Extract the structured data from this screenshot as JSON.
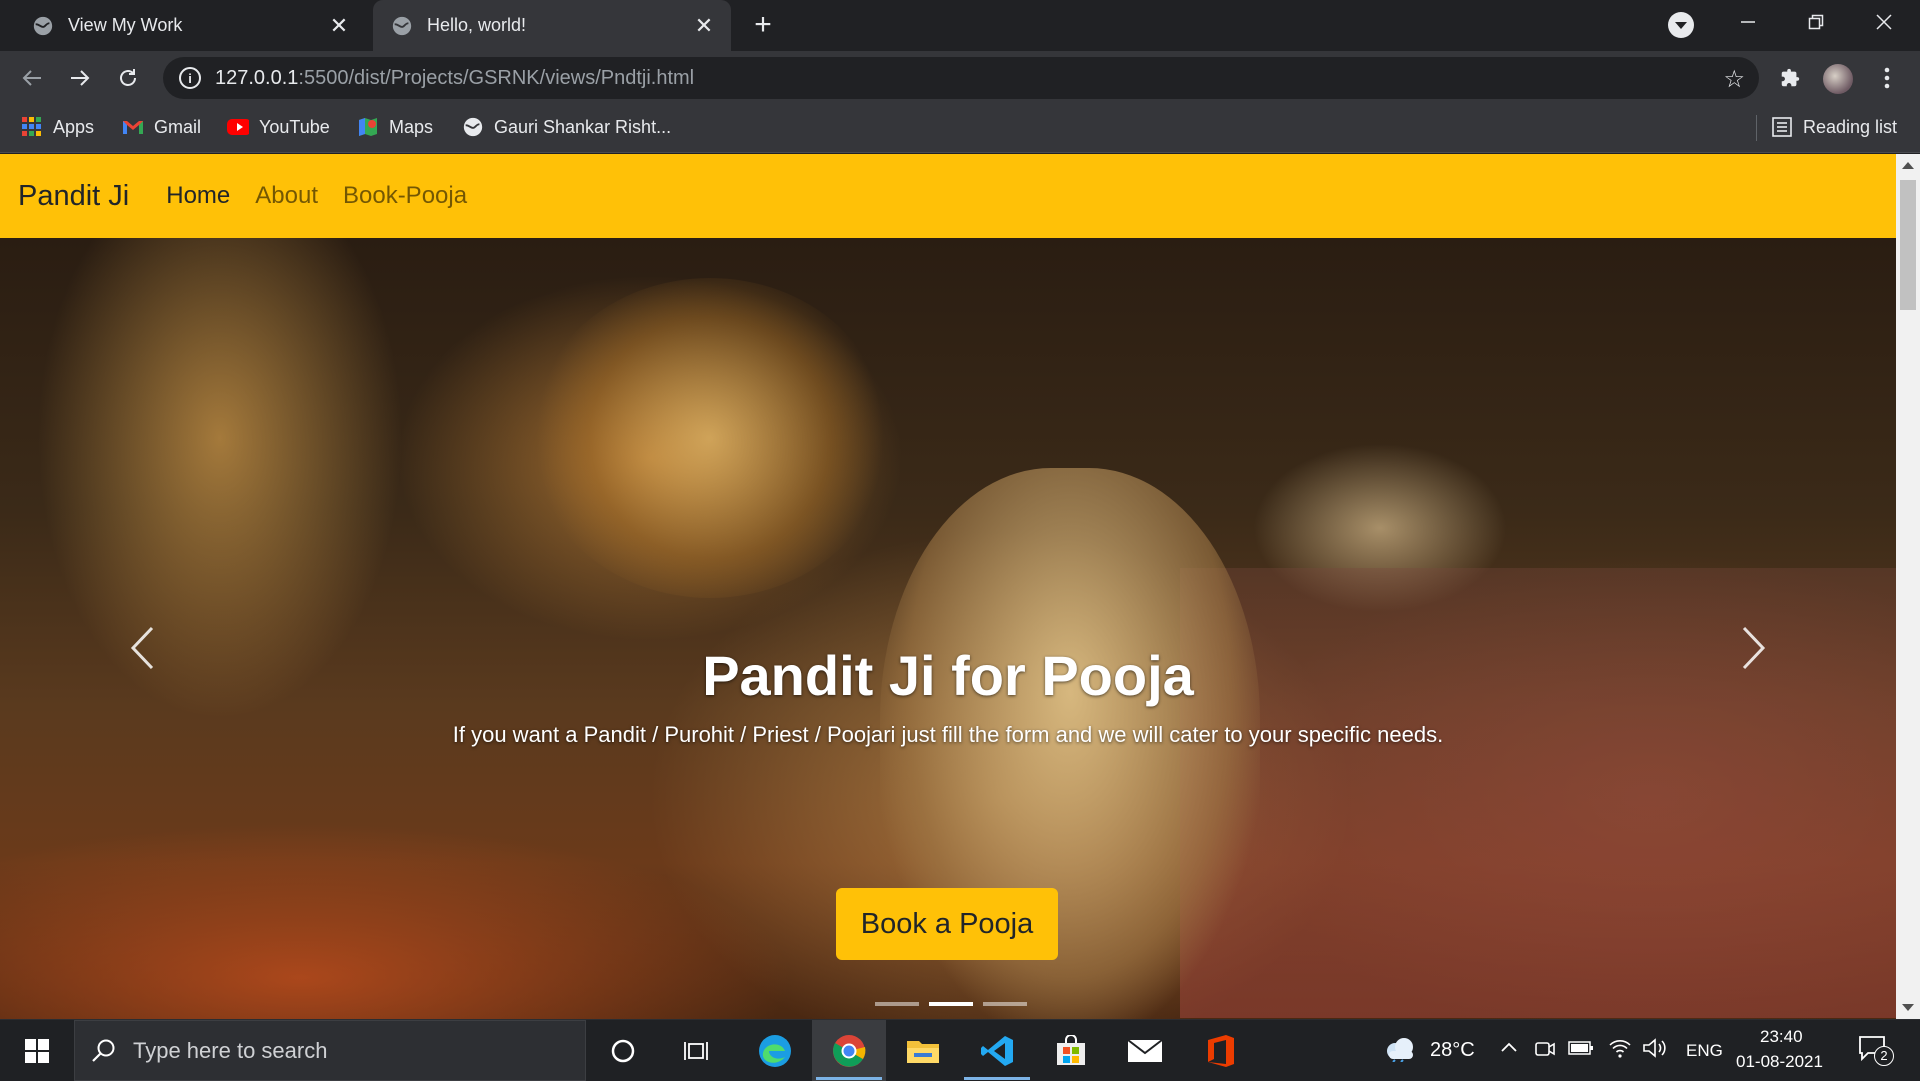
{
  "browser": {
    "tabs": [
      {
        "title": "View My Work",
        "active": false
      },
      {
        "title": "Hello, world!",
        "active": true
      }
    ],
    "url": {
      "host": "127.0.0.1",
      "rest": ":5500/dist/Projects/GSRNK/views/Pndtji.html"
    },
    "bookmarks": [
      {
        "label": "Apps",
        "icon": "apps-grid-icon"
      },
      {
        "label": "Gmail",
        "icon": "gmail-icon"
      },
      {
        "label": "YouTube",
        "icon": "youtube-icon"
      },
      {
        "label": "Maps",
        "icon": "maps-icon"
      },
      {
        "label": "Gauri Shankar Risht...",
        "icon": "globe-icon"
      }
    ],
    "reading_list": "Reading list"
  },
  "page": {
    "brand": "Pandit Ji",
    "nav": [
      {
        "label": "Home",
        "active": true
      },
      {
        "label": "About",
        "active": false
      },
      {
        "label": "Book-Pooja",
        "active": false
      }
    ],
    "hero": {
      "title": "Pandit Ji for Pooja",
      "subtitle": "If you want a Pandit / Purohit / Priest / Poojari just fill the form and we will cater to your specific needs.",
      "cta": "Book a Pooja",
      "indicators": 3,
      "active_indicator": 1
    },
    "accent": "#ffc107"
  },
  "taskbar": {
    "search_placeholder": "Type here to search",
    "weather": "28°C",
    "language": "ENG",
    "time": "23:40",
    "date": "01-08-2021",
    "notifications": "2"
  }
}
